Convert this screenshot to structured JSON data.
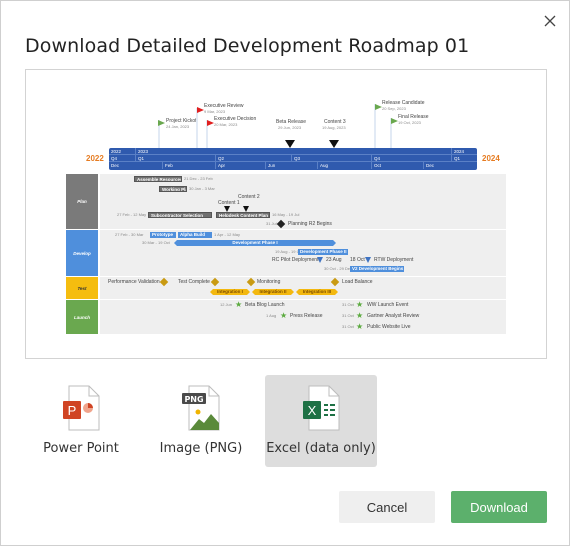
{
  "dialog": {
    "title": "Download Detailed Development Roadmap 01",
    "close_icon": "close-icon"
  },
  "preview": {
    "start_year": "2022",
    "end_year": "2024",
    "scale": {
      "years": [
        "2022",
        "2023",
        "2024"
      ],
      "quarters": [
        "Q4",
        "Q1",
        "Q2",
        "Q3",
        "Q4",
        "Q1"
      ],
      "months": [
        "Dec",
        "Feb",
        "Apr",
        "Jun",
        "Aug",
        "Oct",
        "Dec"
      ]
    },
    "top_milestones": [
      {
        "label": "Project Kickoff",
        "date": "24 Jan, 2023",
        "type": "green-flag"
      },
      {
        "label": "Executive Review",
        "date": "9 Mar, 2023",
        "type": "red-flag"
      },
      {
        "label": "Executive Decision",
        "date": "20 Mar, 2023",
        "type": "red-flag"
      },
      {
        "label": "Beta Release",
        "date": "29 Jun, 2023",
        "type": "black-triangle"
      },
      {
        "label": "Content 3",
        "date": "19 Aug, 2023",
        "type": "black-triangle"
      },
      {
        "label": "Release Candidate",
        "date": "20 Sep, 2023",
        "type": "green-flag"
      },
      {
        "label": "Final Release",
        "date": "19 Oct, 2023",
        "type": "green-flag"
      }
    ],
    "lanes": [
      {
        "name": "Plan",
        "color": "#7a7a7a",
        "tasks": [
          {
            "label": "Assemble Resources",
            "dates": "21 Dec - 23 Feb"
          },
          {
            "label": "Working Plan",
            "dates": "30 Jan - 3 Mar"
          },
          {
            "label": "Subcontractor Selection",
            "dates": "27 Feb - 12 May"
          },
          {
            "label": "Helpdesk Content Plan",
            "dates": "16 May - 19 Jul"
          }
        ],
        "milestones": [
          {
            "label": "Content 1"
          },
          {
            "label": "Content 2"
          },
          {
            "label": "Planning R2 Begins",
            "date": "31 Jul"
          }
        ]
      },
      {
        "name": "Develop",
        "color": "#4f8fdc",
        "tasks": [
          {
            "label": "Prototype",
            "dates": "27 Feb - 30 Mar"
          },
          {
            "label": "Alpha Build",
            "dates": "1 Apr - 12 May"
          },
          {
            "label": "Development Phase I",
            "dates": "30 Mar - 19 Oct"
          },
          {
            "label": "Development Phase II",
            "dates": "19 Aug - 19 Oct"
          },
          {
            "label": "V2 Development Begins",
            "dates": "30 Oct - 29 Dec"
          }
        ],
        "milestones": [
          {
            "label": "RC Pilot Deployment",
            "date": "23 Aug"
          },
          {
            "label": "RTW Deployment",
            "date": "18 Oct"
          }
        ]
      },
      {
        "name": "Test",
        "color": "#f3b80f",
        "tasks": [
          {
            "label": "Integration I"
          },
          {
            "label": "Integration II"
          },
          {
            "label": "Integration III"
          }
        ],
        "milestones": [
          {
            "label": "Performance Validation"
          },
          {
            "label": "Test Complete"
          },
          {
            "label": "Monitoring"
          },
          {
            "label": "Load Balance"
          }
        ]
      },
      {
        "name": "Launch",
        "color": "#6aa84f",
        "milestones": [
          {
            "label": "Beta Blog Launch",
            "date": "12 Jun"
          },
          {
            "label": "Press Release",
            "date": "1 Aug"
          },
          {
            "label": "WW Launch Event",
            "date": "31 Oct"
          },
          {
            "label": "Gartner Analyst Review",
            "date": "31 Oct"
          },
          {
            "label": "Public Website Live",
            "date": "31 Oct"
          }
        ]
      }
    ]
  },
  "formats": [
    {
      "label": "Power Point",
      "icon": "powerpoint-file-icon",
      "selected": false
    },
    {
      "label": "Image (PNG)",
      "icon": "png-file-icon",
      "selected": false
    },
    {
      "label": "Excel (data only)",
      "icon": "excel-file-icon",
      "selected": true
    }
  ],
  "buttons": {
    "cancel": "Cancel",
    "download": "Download"
  },
  "colors": {
    "download": "#5cb06c",
    "selected_format_bg": "#dddddd",
    "timescale": "#2f5aae",
    "year_accent": "#e67c22"
  }
}
